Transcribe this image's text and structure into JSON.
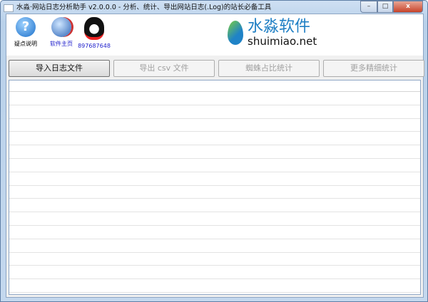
{
  "window": {
    "title": "水淼·网站日志分析助手 v2.0.0.0 - 分析、统计、导出网站日志(.Log)的站长必备工具",
    "min": "–",
    "max": "□",
    "close": "x"
  },
  "toolbar": [
    {
      "label": "疑点说明",
      "icon": "help-icon",
      "color": "#111111"
    },
    {
      "label": "软件主页",
      "icon": "globe-icon",
      "color": "#2222cc"
    },
    {
      "label": "897687648",
      "icon": "qq-penguin-icon",
      "color": "#2222cc"
    }
  ],
  "logo": {
    "name": "水淼软件",
    "url": "shuimiao.net"
  },
  "buttons": [
    {
      "label": "导入日志文件",
      "enabled": true
    },
    {
      "label": "导出 csv 文件",
      "enabled": false
    },
    {
      "label": "蜘蛛占比统计",
      "enabled": false
    },
    {
      "label": "更多精细统计",
      "enabled": false
    }
  ]
}
